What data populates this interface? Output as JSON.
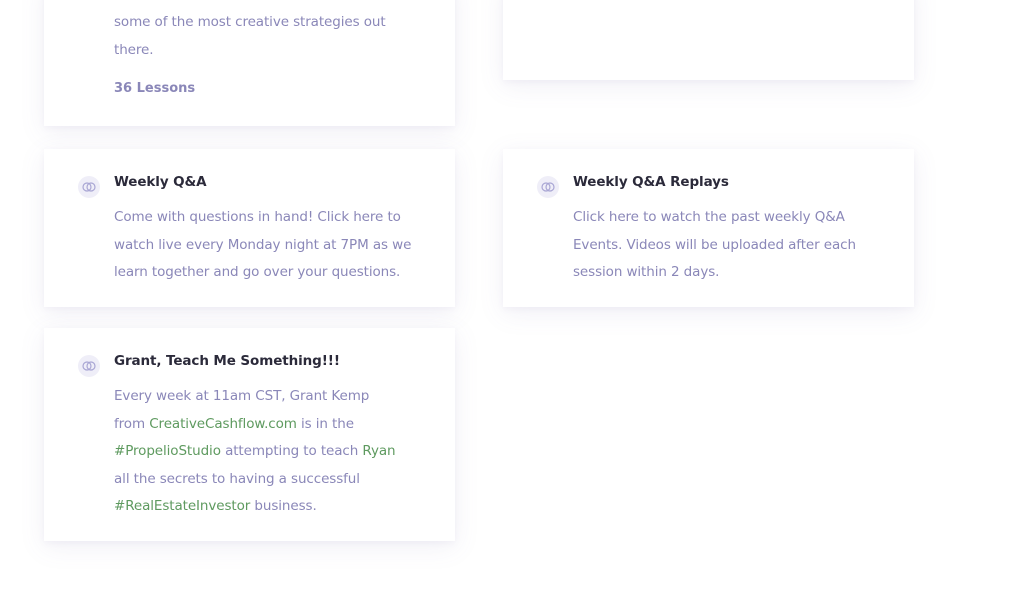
{
  "cards": {
    "top_left": {
      "description_lines": [
        "some of the most creative strategies out",
        "there."
      ],
      "lessons": "36 Lessons"
    },
    "weekly_qa": {
      "icon": "course-icon",
      "title": "Weekly Q&A",
      "description": "Come with questions in hand! Click here to watch live every Monday night at 7PM as we learn together and go over your questions."
    },
    "weekly_qa_replays": {
      "icon": "course-icon",
      "title": "Weekly Q&A Replays",
      "description": "Click here to watch the past weekly Q&A Events. Videos will be uploaded after each session within 2 days."
    },
    "grant": {
      "icon": "course-icon",
      "title": "Grant, Teach Me Something!!!",
      "desc_part1": "Every week at 11am CST, Grant Kemp from ",
      "link_site": "CreativeCashflow.com",
      "desc_part2": " is in the ",
      "hashtag_studio": "#PropelioStudio",
      "desc_part3": " attempting to teach ",
      "name_ryan": "Ryan",
      "desc_part4": " all the secrets to having a successful ",
      "hashtag_investor": "#RealEstateInvestor",
      "desc_part5": " business."
    }
  },
  "colors": {
    "title": "#2b2a3a",
    "text": "#8a87b8",
    "highlight": "#5e9a5f",
    "icon_bg": "#efeef8"
  }
}
